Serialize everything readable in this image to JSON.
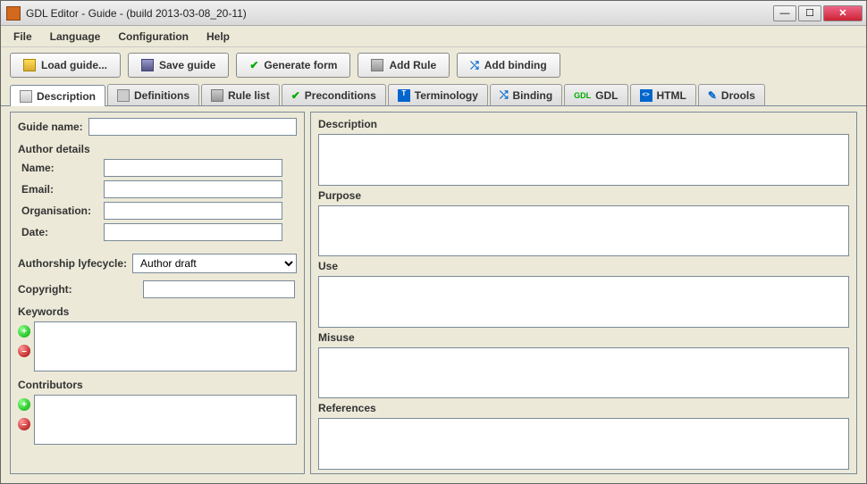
{
  "title": "GDL Editor - Guide - (build 2013-03-08_20-11)",
  "menu": {
    "file": "File",
    "language": "Language",
    "configuration": "Configuration",
    "help": "Help"
  },
  "toolbar": {
    "load": "Load guide...",
    "save": "Save guide",
    "generate": "Generate form",
    "addrule": "Add Rule",
    "addbinding": "Add binding"
  },
  "tabs": {
    "description": "Description",
    "definitions": "Definitions",
    "rulelist": "Rule list",
    "preconditions": "Preconditions",
    "terminology": "Terminology",
    "binding": "Binding",
    "gdl": "GDL",
    "html": "HTML",
    "drools": "Drools"
  },
  "left": {
    "guidename_lbl": "Guide name:",
    "guidename_val": "",
    "authordetails": "Author details",
    "name_lbl": "Name:",
    "name_val": "",
    "email_lbl": "Email:",
    "email_val": "",
    "org_lbl": "Organisation:",
    "org_val": "",
    "date_lbl": "Date:",
    "date_val": "",
    "lifecycle_lbl": "Authorship lyfecycle:",
    "lifecycle_val": "Author draft",
    "copyright_lbl": "Copyright:",
    "copyright_val": "",
    "keywords": "Keywords",
    "contributors": "Contributors"
  },
  "right": {
    "description": "Description",
    "purpose": "Purpose",
    "use": "Use",
    "misuse": "Misuse",
    "references": "References"
  }
}
